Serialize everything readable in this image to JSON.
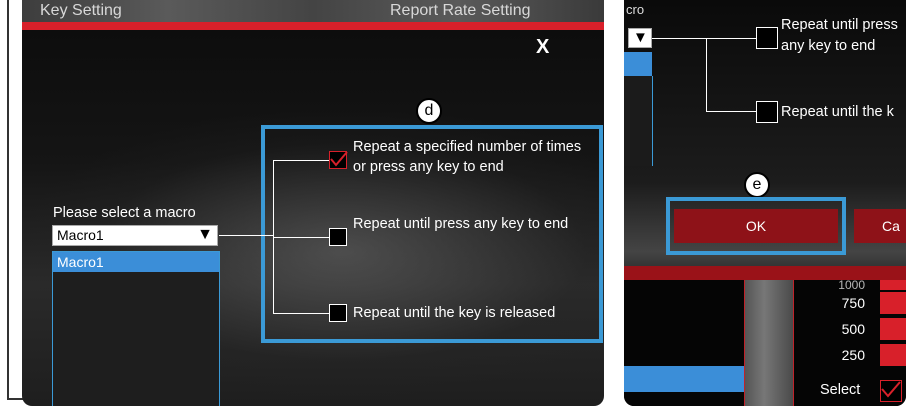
{
  "left_panel": {
    "tabs": {
      "key_setting": "Key Setting",
      "report_rate": "Report Rate Setting"
    },
    "close": "X",
    "badge": "d",
    "select_label": "Please select a macro",
    "selected_macro": "Macro1",
    "dropdown_arrow": "▼",
    "macro_list": [
      "Macro1"
    ],
    "options": [
      {
        "label": "Repeat a specified number of times or press any key to end",
        "checked": true
      },
      {
        "label": "Repeat until press any key to end",
        "checked": false
      },
      {
        "label": "Repeat until the key is released",
        "checked": false
      }
    ]
  },
  "right_panel": {
    "top_label": "cro",
    "dropdown_arrow": "▼",
    "options": [
      {
        "label": "Repeat until press any key to end",
        "checked": false
      },
      {
        "label": "Repeat until the k",
        "checked": false
      }
    ],
    "badge": "e",
    "ok_button": "OK",
    "cancel_button": "Ca",
    "values": [
      "1000",
      "750",
      "500",
      "250"
    ],
    "select_label": "Select"
  },
  "colors": {
    "accent_red": "#d8202a",
    "highlight_blue": "#3b9ad6",
    "ok_red": "#8e1218"
  }
}
